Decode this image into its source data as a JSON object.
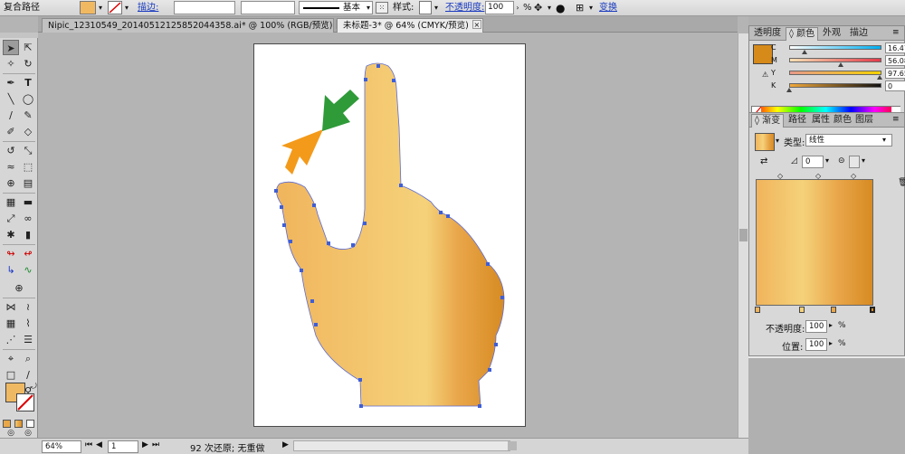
{
  "control_bar": {
    "object_type": "复合路径",
    "stroke_label": "描边:",
    "stroke_profile": "基本",
    "style_label": "样式:",
    "opacity_label": "不透明度:",
    "opacity_value": "100",
    "opacity_unit": "%",
    "transform_label": "变换"
  },
  "doc_tabs": [
    {
      "title": "Nipic_12310549_20140512125852044358.ai* @ 100% (RGB/预览)"
    },
    {
      "title": "未标题-3* @ 64% (CMYK/预览)"
    }
  ],
  "color_panel": {
    "tabs": [
      "透明度",
      "颜色",
      "外观",
      "描边"
    ],
    "active_tab": "颜色",
    "fill_color": "#d58a1a",
    "sliders": [
      {
        "label": "C",
        "value": "16.47",
        "unit": "%",
        "pos": 0.165
      },
      {
        "label": "M",
        "value": "56.08",
        "unit": "%",
        "pos": 0.561
      },
      {
        "label": "Y",
        "value": "97.65",
        "unit": "%",
        "pos": 0.977
      },
      {
        "label": "K",
        "value": "0",
        "unit": "%",
        "pos": 0
      }
    ]
  },
  "gradient_panel": {
    "tabs": [
      "渐变",
      "路径",
      "属性",
      "颜色",
      "图层"
    ],
    "active_tab": "渐变",
    "type_label": "类型:",
    "type_value": "线性",
    "angle_value": "0",
    "opacity_label": "不透明度:",
    "opacity_value": "100",
    "position_label": "位置:",
    "position_value": "100",
    "unit": "%",
    "colors": [
      "#f0b45c",
      "#f5d27a",
      "#e9a64a",
      "#d78b22"
    ]
  },
  "status_bar": {
    "zoom": "64%",
    "page": "1",
    "message": "92 次还原; 无重做"
  }
}
